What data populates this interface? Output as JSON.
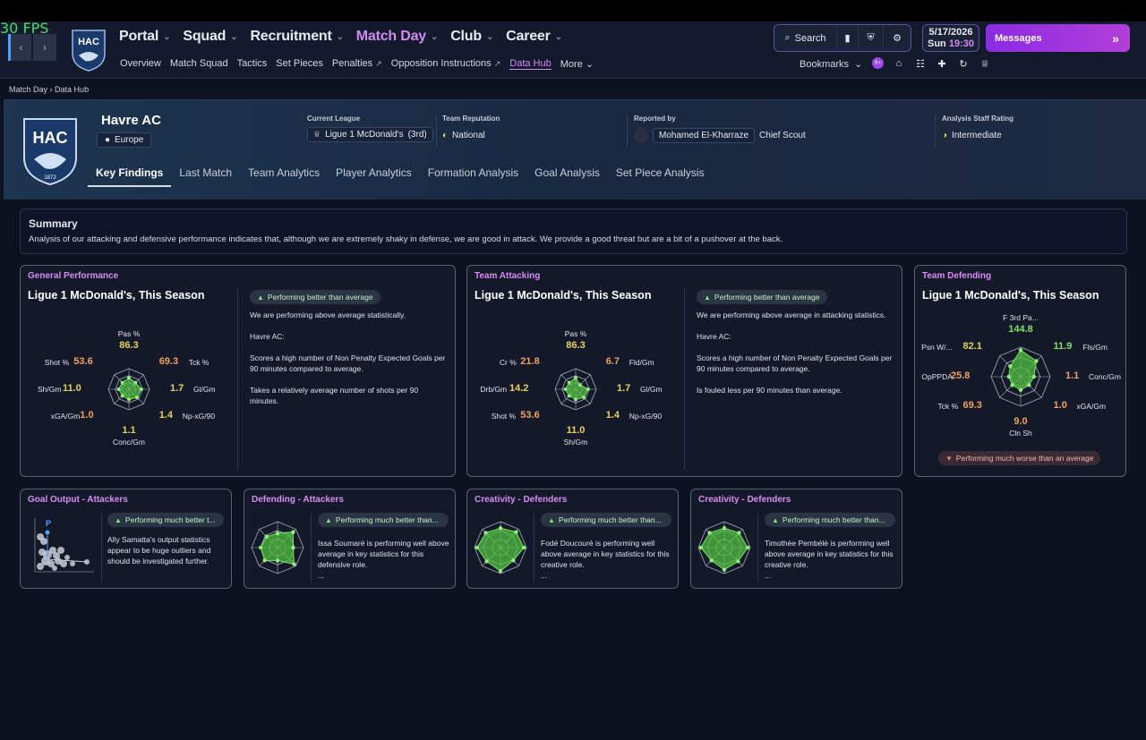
{
  "fps": "30 FPS",
  "nav": {
    "main": [
      {
        "label": "Portal"
      },
      {
        "label": "Squad"
      },
      {
        "label": "Recruitment"
      },
      {
        "label": "Match Day",
        "active": true
      },
      {
        "label": "Club"
      },
      {
        "label": "Career"
      }
    ],
    "sub": [
      "Overview",
      "Match Squad",
      "Tactics",
      "Set Pieces",
      "Penalties",
      "Opposition Instructions",
      "Data Hub",
      "More"
    ],
    "search": "Search",
    "date": "5/17/2026",
    "day": "Sun",
    "time": "19:30",
    "messages": "Messages",
    "bookmarks": "Bookmarks",
    "badge": "9+"
  },
  "crumb": {
    "parent": "Match Day",
    "current": "Data Hub"
  },
  "club": {
    "name": "Havre AC",
    "country": "Europe",
    "logo_text": "HAC",
    "logo_year": "1872"
  },
  "info": {
    "league_label": "Current League",
    "league": "Ligue 1 McDonald's",
    "league_pos": "(3rd)",
    "rep_label": "Team Reputation",
    "rep": "National",
    "reported_label": "Reported by",
    "scout": "Mohamed El-Kharraze",
    "scout_role": "Chief Scout",
    "staff_label": "Analysis Staff Rating",
    "staff": "Intermediate"
  },
  "tabs": [
    "Key Findings",
    "Last Match",
    "Team Analytics",
    "Player Analytics",
    "Formation Analysis",
    "Goal Analysis",
    "Set Piece Analysis"
  ],
  "summary": {
    "title": "Summary",
    "text": "Analysis of our attacking and defensive performance indicates that, although we are extremely shaky in defense, we are good in attack. We provide a good threat but are a bit of a pushover at the back."
  },
  "cards": {
    "general": {
      "title": "General Performance",
      "sub": "Ligue 1 McDonald's, This Season",
      "pill": "Performing better than average",
      "p1": "We are performing above average statistically.",
      "p2": "Havre AC:",
      "p3": "Scores a high number of Non Penalty Expected Goals per 90 minutes compared to average.",
      "p4": "Takes a relatively average number of shots per 90 minutes.",
      "radar": [
        {
          "label": "Pas %",
          "value": "86.3",
          "level": 0.55
        },
        {
          "label": "Tck %",
          "value": "69.3",
          "level": 0.45
        },
        {
          "label": "Gl/Gm",
          "value": "1.7",
          "level": 0.6
        },
        {
          "label": "Np-xG/90",
          "value": "1.4",
          "level": 0.55
        },
        {
          "label": "Conc/Gm",
          "value": "1.1",
          "level": 0.5
        },
        {
          "label": "xGA/Gm",
          "value": "1.0",
          "level": 0.45
        },
        {
          "label": "Sh/Gm",
          "value": "11.0",
          "level": 0.5
        },
        {
          "label": "Shot %",
          "value": "53.6",
          "level": 0.45
        }
      ]
    },
    "attack": {
      "title": "Team Attacking",
      "sub": "Ligue 1 McDonald's, This Season",
      "pill": "Performing better than average",
      "p1": "We are performing above average in attacking statistics.",
      "p2": "Havre AC:",
      "p3": "Scores a high number of Non Penalty Expected Goals per 90 minutes compared to average.",
      "p4": "Is fouled less per 90 minutes than average.",
      "radar": [
        {
          "label": "Pas %",
          "value": "86.3",
          "level": 0.55
        },
        {
          "label": "Fld/Gm",
          "value": "6.7",
          "level": 0.3
        },
        {
          "label": "Gl/Gm",
          "value": "1.7",
          "level": 0.6
        },
        {
          "label": "Np-xG/90",
          "value": "1.4",
          "level": 0.55
        },
        {
          "label": "Sh/Gm",
          "value": "11.0",
          "level": 0.5
        },
        {
          "label": "Shot %",
          "value": "53.6",
          "level": 0.45
        },
        {
          "label": "Drb/Gm",
          "value": "14.2",
          "level": 0.5
        },
        {
          "label": "Cr %",
          "value": "21.8",
          "level": 0.45
        }
      ]
    },
    "defend": {
      "title": "Team Defending",
      "sub": "Ligue 1 McDonald's, This Season",
      "pill": "Performing much worse than an average",
      "radar": [
        {
          "label": "F 3rd Pa...",
          "value": "144.8",
          "level": 0.9
        },
        {
          "label": "Fls/Gm",
          "value": "11.9",
          "level": 0.75
        },
        {
          "label": "Conc/Gm",
          "value": "1.1",
          "level": 0.45
        },
        {
          "label": "xGA/Gm",
          "value": "1.0",
          "level": 0.4
        },
        {
          "label": "Cln Sh",
          "value": "9.0",
          "level": 0.45
        },
        {
          "label": "Tck %",
          "value": "69.3",
          "level": 0.4
        },
        {
          "label": "OpPPDA",
          "value": "25.8",
          "level": 0.4
        },
        {
          "label": "Psn W/...",
          "value": "82.1",
          "level": 0.5
        }
      ]
    }
  },
  "small": [
    {
      "title": "Goal Output - Attackers",
      "pill": "Performing much better t...",
      "text": "Ally Samatta's output statistics appear to be huge outliers and should be investigated further.",
      "scatter_label": "P"
    },
    {
      "title": "Defending - Attackers",
      "pill": "Performing much better than...",
      "text": "Issa Soumaré is performing well above average in key statistics for this defensive role.",
      "more": "..."
    },
    {
      "title": "Creativity - Defenders",
      "pill": "Performing much better than...",
      "text": "Fodé Doucouré is performing well above average in key statistics for this creative role.",
      "more": "..."
    },
    {
      "title": "Creativity - Defenders",
      "pill": "Performing much better than...",
      "text": "Timothée Pembélé is performing well above average in key statistics for this creative role.",
      "more": "..."
    }
  ]
}
